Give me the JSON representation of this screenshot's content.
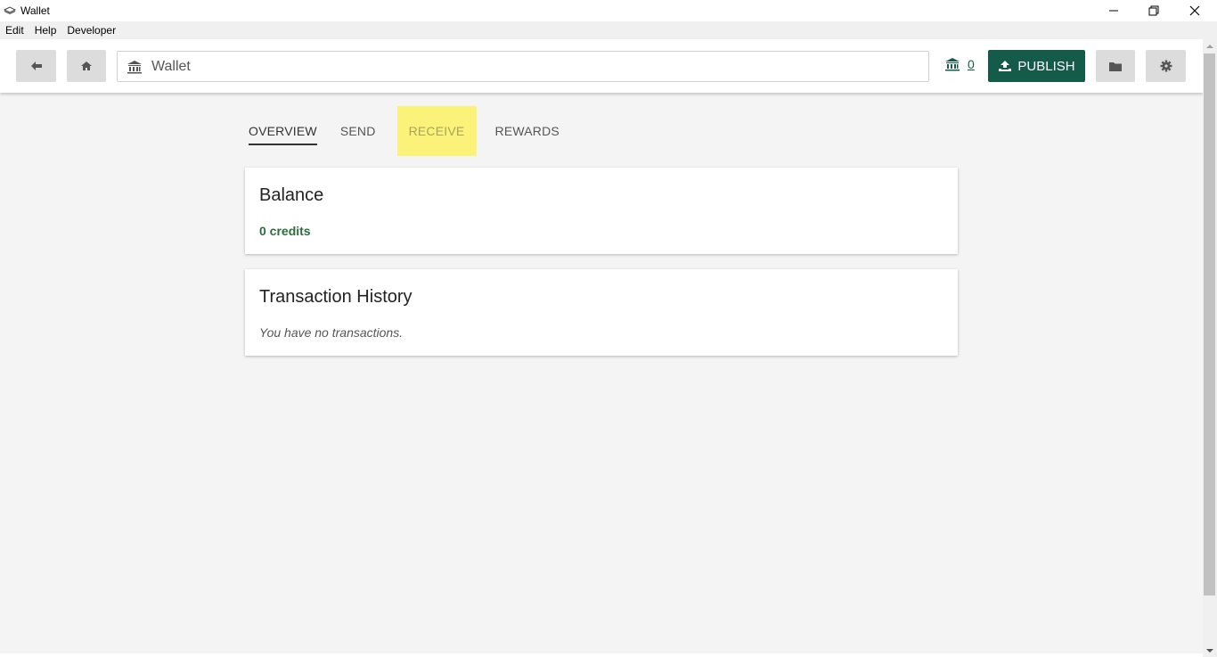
{
  "window": {
    "title": "Wallet"
  },
  "menu": {
    "items": [
      "Edit",
      "Help",
      "Developer"
    ]
  },
  "header": {
    "address_text": "Wallet",
    "credit_balance": "0",
    "publish_label": "PUBLISH"
  },
  "tabs": [
    {
      "label": "OVERVIEW",
      "active": true
    },
    {
      "label": "SEND",
      "active": false
    },
    {
      "label": "RECEIVE",
      "active": false,
      "highlighted": true
    },
    {
      "label": "REWARDS",
      "active": false
    }
  ],
  "balance_card": {
    "title": "Balance",
    "value": "0 credits"
  },
  "history_card": {
    "title": "Transaction History",
    "empty_message": "You have no transactions."
  },
  "colors": {
    "brand": "#155b4a",
    "highlight": "#fbf27a",
    "credits_text": "#2a6e3a"
  }
}
